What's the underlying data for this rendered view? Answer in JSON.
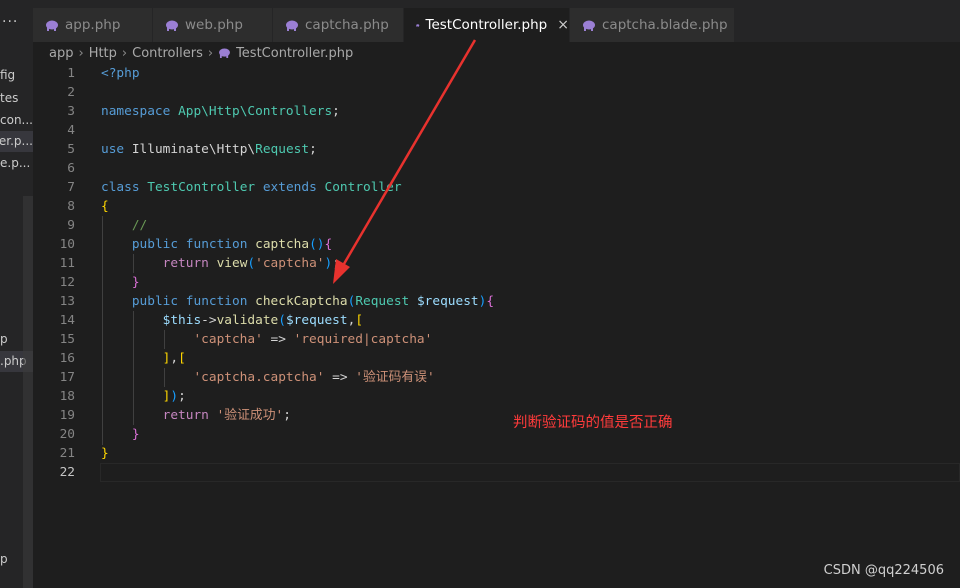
{
  "sidebar": {
    "more_label": "...",
    "items": [
      {
        "label": "fig",
        "selected": false
      },
      {
        "label": "tes",
        "selected": false
      },
      {
        "label": "con...",
        "selected": false
      },
      {
        "label": "er.p...",
        "selected": true
      },
      {
        "label": "e.p...",
        "selected": false
      },
      {
        "label": "p",
        "selected": false
      },
      {
        "label": ".php",
        "selected": true
      },
      {
        "label": "p",
        "selected": false
      }
    ]
  },
  "tabs": [
    {
      "label": "app.php",
      "active": false
    },
    {
      "label": "web.php",
      "active": false
    },
    {
      "label": "captcha.php",
      "active": false
    },
    {
      "label": "TestController.php",
      "active": true,
      "close": "×"
    },
    {
      "label": "captcha.blade.php",
      "active": false
    }
  ],
  "breadcrumb": [
    "app",
    "Http",
    "Controllers",
    "TestController.php"
  ],
  "editor": {
    "line_numbers": [
      "1",
      "2",
      "3",
      "4",
      "5",
      "6",
      "7",
      "8",
      "9",
      "10",
      "11",
      "12",
      "13",
      "14",
      "15",
      "16",
      "17",
      "18",
      "19",
      "20",
      "21",
      "22"
    ],
    "current_line": "22"
  },
  "code": {
    "l1_open": "<?php",
    "l3_kw": "namespace",
    "l3_ns": "App\\Http\\Controllers",
    "l3_end": ";",
    "l5_kw": "use",
    "l5_ns": "Illuminate\\Http\\",
    "l5_cls": "Request",
    "l5_end": ";",
    "l7_kw": "class",
    "l7_cls": "TestController",
    "l7_ext": "extends",
    "l7_parent": "Controller",
    "l8_brace": "{",
    "l9_comment": "//",
    "l10_public": "public",
    "l10_function": "function",
    "l10_name": "captcha",
    "l10_parens": "()",
    "l10_brace": "{",
    "l11_return": "return",
    "l11_fn": "view",
    "l11_open": "(",
    "l11_str": "'captcha'",
    "l11_close": ")",
    "l11_end": ";",
    "l12_brace": "}",
    "l13_public": "public",
    "l13_function": "function",
    "l13_name": "checkCaptcha",
    "l13_open": "(",
    "l13_type": "Request",
    "l13_var": "$request",
    "l13_close": ")",
    "l13_brace": "{",
    "l14_this": "$this",
    "l14_arrow": "->",
    "l14_fn": "validate",
    "l14_open": "(",
    "l14_var": "$request",
    "l14_comma": ",",
    "l14_bracket": "[",
    "l15_key": "'captcha'",
    "l15_op": " => ",
    "l15_val": "'required|captcha'",
    "l16_close": "]",
    "l16_comma": ",",
    "l16_open": "[",
    "l17_key": "'captcha.captcha'",
    "l17_op": " => ",
    "l17_val": "'验证码有误'",
    "l18_close": "]",
    "l18_paren": ")",
    "l18_end": ";",
    "l19_return": "return",
    "l19_str": "'验证成功'",
    "l19_end": ";",
    "l20_brace": "}",
    "l21_brace": "}"
  },
  "annotation": "判断验证码的值是否正确",
  "watermark": "CSDN @qq224506",
  "colors": {
    "arrow": "#e8322e",
    "annotation": "#ff3b3b",
    "php_icon": "#9b7fd4"
  }
}
